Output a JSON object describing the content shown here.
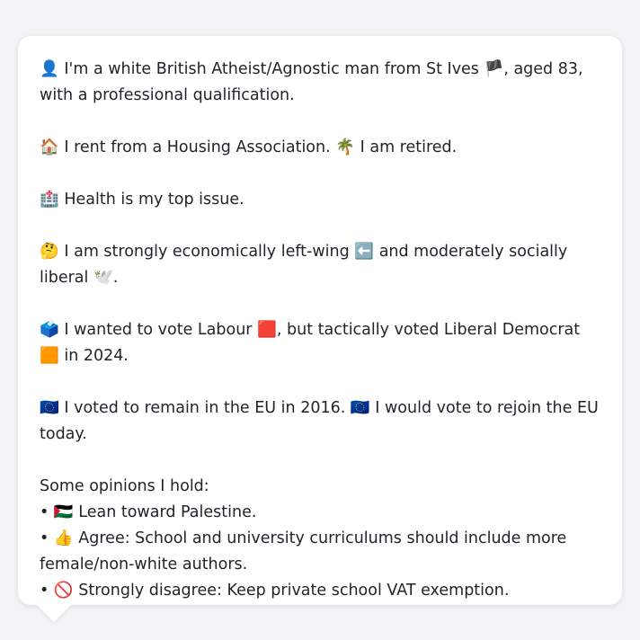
{
  "bio": {
    "identity": {
      "icon": "👤",
      "text_a": "I'm a white British Atheist/Agnostic man from St Ives",
      "flag": "🏴",
      "text_b": ", aged 83, with a professional qualification."
    },
    "housing": {
      "icon": "🏠",
      "text_a": "I rent from a Housing Association.",
      "icon2": "🌴",
      "text_b": "I am retired."
    },
    "issue": {
      "icon": "🏥",
      "text": "Health is my top issue."
    },
    "ideology": {
      "icon": "🤔",
      "text_a": "I am strongly economically left-wing",
      "icon2": "⬅️",
      "text_b": "and moderately socially liberal",
      "icon3": "🕊️",
      "text_c": "."
    },
    "vote": {
      "icon": "🗳️",
      "text_a": "I wanted to vote Labour",
      "icon2": "🟥",
      "text_b": ", but tactically voted Liberal Democrat",
      "icon3": "🟧",
      "text_c": "in 2024."
    },
    "eu": {
      "icon": "🇪🇺",
      "text_a": "I voted to remain in the EU in 2016.",
      "icon2": "🇪🇺",
      "text_b": "I would vote to rejoin the EU today."
    }
  },
  "opinions": {
    "heading": "Some opinions I hold:",
    "bullet": "•",
    "items": [
      {
        "icon": "🇵🇸",
        "text": "Lean toward Palestine."
      },
      {
        "icon": "👍",
        "text": "Agree: School and university curriculums should include more female/non-white authors."
      },
      {
        "icon": "🚫",
        "text": "Strongly disagree: Keep private school VAT exemption."
      }
    ]
  },
  "icons": {
    "identity": "person-icon",
    "housing": "house-icon",
    "retired": "palm-tree-icon",
    "health": "hospital-icon",
    "thinking": "thinking-face-icon",
    "left": "left-arrow-icon",
    "liberal": "dove-icon",
    "ballot": "ballot-box-icon",
    "labour": "red-square-icon",
    "libdem": "orange-square-icon",
    "eu": "eu-flag-icon",
    "palestine": "palestine-flag-icon",
    "agree": "thumbs-up-icon",
    "disagree": "prohibited-icon"
  },
  "colors": {
    "background": "#f2f3f5",
    "card": "#ffffff",
    "text": "#1f2328"
  }
}
